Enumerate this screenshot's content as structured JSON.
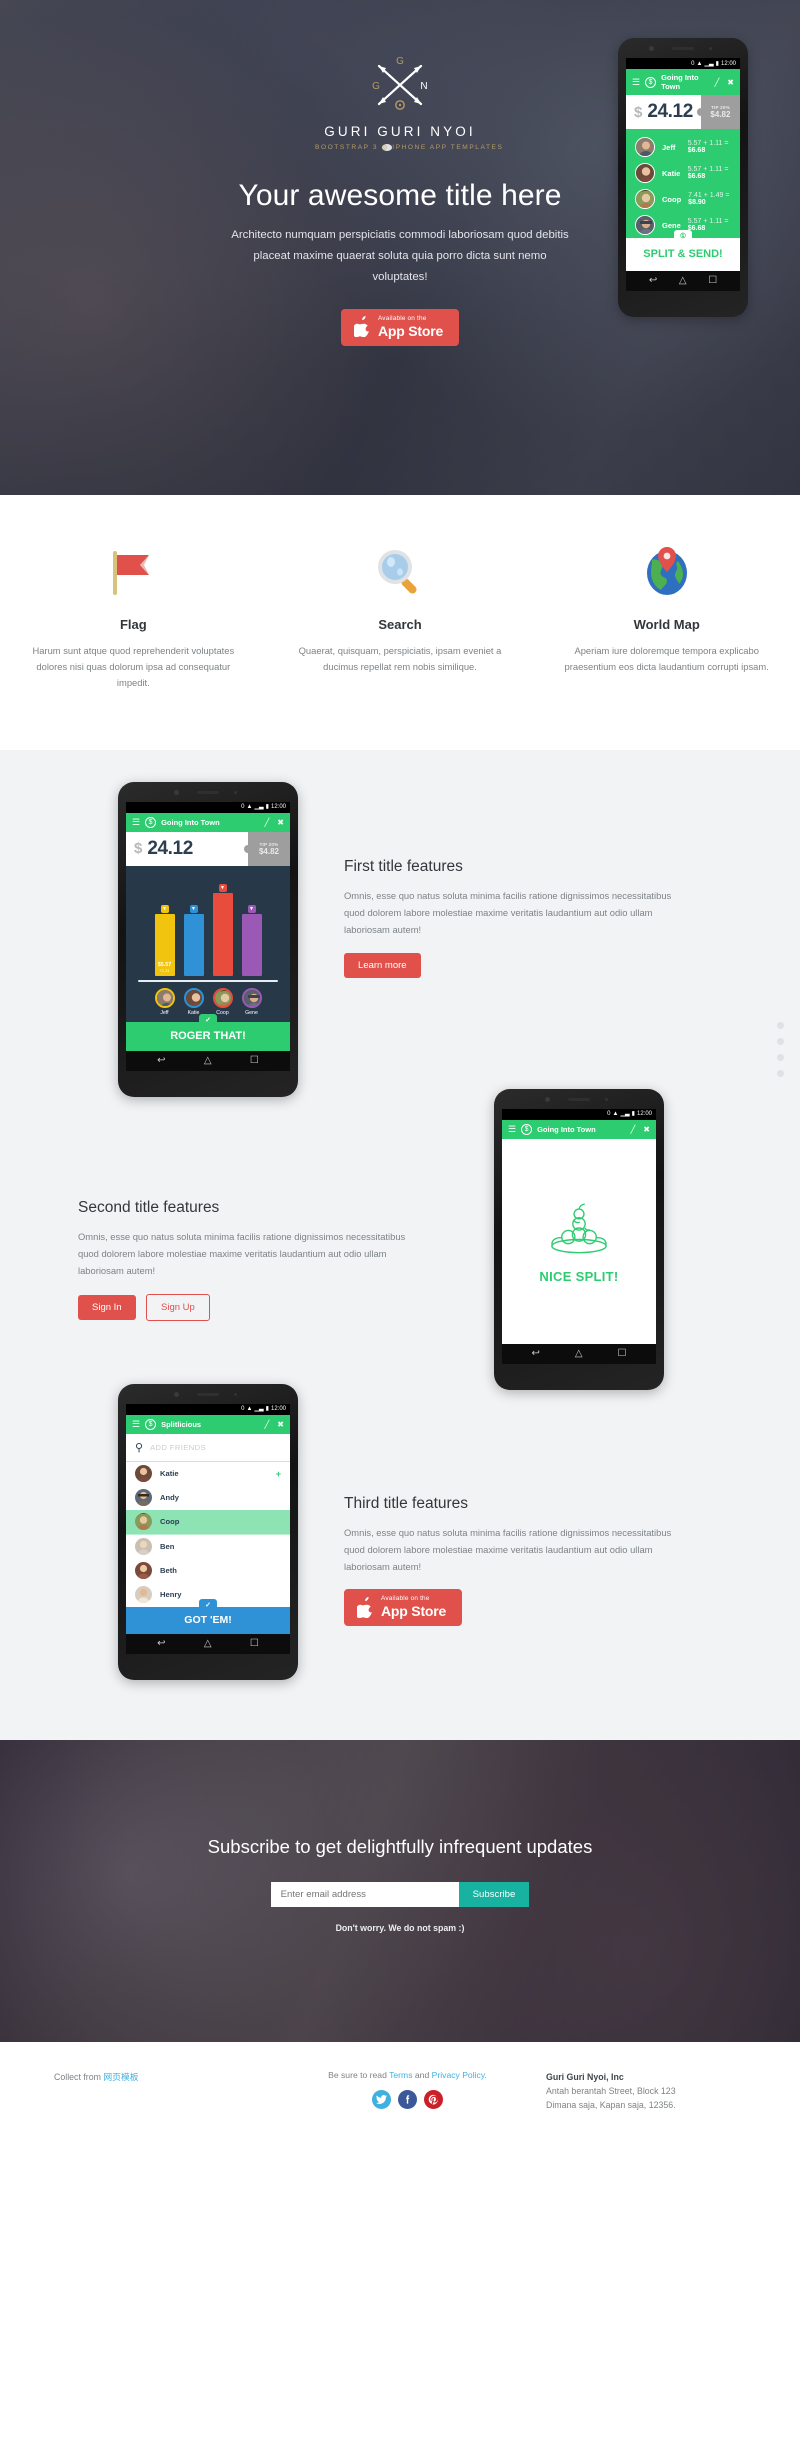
{
  "hero": {
    "logo_name": "GURI GURI NYOI",
    "logo_tagline_left": "BOOTSTRAP 3",
    "logo_tagline_right": "IPHONE APP TEMPLATES",
    "title": "Your awesome title here",
    "subtitle": "Architecto numquam perspiciatis commodi laboriosam quod debitis placeat maxime quaerat soluta quia porro dicta sunt nemo voluptates!",
    "appstore_small": "Available on the",
    "appstore_big": "App Store"
  },
  "phone_hero": {
    "status_time": "12:00",
    "status_battery": "0",
    "app_title": "Going Into Town",
    "currency": "$",
    "amount": "24.12",
    "tip_label": "TIP 20%",
    "tip_value": "$4.82",
    "friends": [
      {
        "name": "Jeff",
        "calc": "5.57 + 1.11 = ",
        "total": "$6.68"
      },
      {
        "name": "Katie",
        "calc": "5.57 + 1.11 = ",
        "total": "$6.68"
      },
      {
        "name": "Coop",
        "calc": "7.41 + 1.49 = ",
        "total": "$8.90"
      },
      {
        "name": "Gene",
        "calc": "5.57 + 1.11 = ",
        "total": "$6.68"
      }
    ],
    "cta": "SPLIT & SEND!"
  },
  "features": [
    {
      "icon": "flag-icon",
      "title": "Flag",
      "text": "Harum sunt atque quod reprehenderit voluptates dolores nisi quas dolorum ipsa ad consequatur impedit."
    },
    {
      "icon": "search-icon",
      "title": "Search",
      "text": "Quaerat, quisquam, perspiciatis, ipsam eveniet a ducimus repellat rem nobis similique."
    },
    {
      "icon": "world-map-icon",
      "title": "World Map",
      "text": "Aperiam iure doloremque tempora explicabo praesentium eos dicta laudantium corrupti ipsam."
    }
  ],
  "section_one": {
    "title": "First title features",
    "text": "Omnis, esse quo natus soluta minima facilis ratione dignissimos necessitatibus quod dolorem labore molestiae maxime veritatis laudantium aut odio ullam laboriosam autem!",
    "button": "Learn more"
  },
  "section_two": {
    "title": "Second title features",
    "text": "Omnis, esse quo natus soluta minima facilis ratione dignissimos necessitatibus quod dolorem labore molestiae maxime veritatis laudantium aut odio ullam laboriosam autem!",
    "button_primary": "Sign In",
    "button_secondary": "Sign Up"
  },
  "section_three": {
    "title": "Third title features",
    "text": "Omnis, esse quo natus soluta minima facilis ratione dignissimos necessitatibus quod dolorem labore molestiae maxime veritatis laudantium aut odio ullam laboriosam autem!",
    "appstore_small": "Available on the",
    "appstore_big": "App Store"
  },
  "phone_chart": {
    "status_time": "12:00",
    "status_battery": "0",
    "app_title": "Going Into Town",
    "currency": "$",
    "amount": "24.12",
    "tip_label": "TIP 20%",
    "tip_value": "$4.82",
    "cta": "ROGER THAT!"
  },
  "chart_data": {
    "type": "bar",
    "title": "Going Into Town",
    "categories": [
      "Jeff",
      "Katie",
      "Coop",
      "Gene"
    ],
    "values": [
      5.57,
      5.57,
      7.41,
      5.57
    ],
    "tips": [
      1.11,
      1.11,
      1.49,
      1.11
    ],
    "totals": [
      6.68,
      6.68,
      8.9,
      6.68
    ],
    "colors": [
      "#f1c40f",
      "#2f92d6",
      "#e74c3c",
      "#9b59b6"
    ],
    "bar_label": "$5.57",
    "bar_sublabel": "+1.11",
    "xlabel": "",
    "ylabel": "",
    "ylim": [
      0,
      9
    ],
    "grid": false,
    "legend": "none"
  },
  "phone_split": {
    "status_time": "12:00",
    "status_battery": "0",
    "app_title": "Going Into Town",
    "message": "NICE SPLIT!"
  },
  "phone_friends": {
    "status_time": "12:00",
    "status_battery": "0",
    "app_title": "Splitlicious",
    "search_placeholder": "ADD FRIENDS",
    "friends": [
      {
        "name": "Katie",
        "selected": false,
        "has_plus": true
      },
      {
        "name": "Andy",
        "selected": false,
        "has_plus": false
      },
      {
        "name": "Coop",
        "selected": true,
        "has_plus": false
      },
      {
        "name": "Ben",
        "selected": false,
        "has_plus": false
      },
      {
        "name": "Beth",
        "selected": false,
        "has_plus": false
      },
      {
        "name": "Henry",
        "selected": false,
        "has_plus": false
      }
    ],
    "cta": "GOT 'EM!"
  },
  "subscribe": {
    "title": "Subscribe to get delightfully infrequent updates",
    "email_placeholder": "Enter email address",
    "email_value": "",
    "button": "Subscribe",
    "note": "Don't worry. We do not spam :)"
  },
  "footer": {
    "collect_prefix": "Collect from ",
    "collect_link": "网页模板",
    "legal_prefix": "Be sure to read ",
    "legal_terms": "Terms",
    "legal_and": " and ",
    "legal_privacy": "Privacy Policy",
    "legal_suffix": ".",
    "socials": [
      {
        "name": "twitter-icon",
        "glyph": "🐦",
        "color": "#3fb0e0"
      },
      {
        "name": "facebook-icon",
        "glyph": "f",
        "color": "#3b5998"
      },
      {
        "name": "pinterest-icon",
        "glyph": "Ⓟ",
        "color": "#cb2027"
      }
    ],
    "company": "Guri Guri Nyoi, Inc",
    "address_line1": "Antah berantah Street, Block 123",
    "address_line2": "Dimana saja, Kapan saja, 12356."
  },
  "nav_dots": [
    {
      "active": false
    },
    {
      "active": false
    },
    {
      "active": false
    },
    {
      "active": false
    }
  ],
  "colors": {
    "accent_red": "#e0514b",
    "accent_green": "#2ecc71",
    "accent_teal": "#18b2a0",
    "accent_blue": "#2f92d6",
    "gold": "#b59b63",
    "gray_bg": "#f2f3f5"
  }
}
